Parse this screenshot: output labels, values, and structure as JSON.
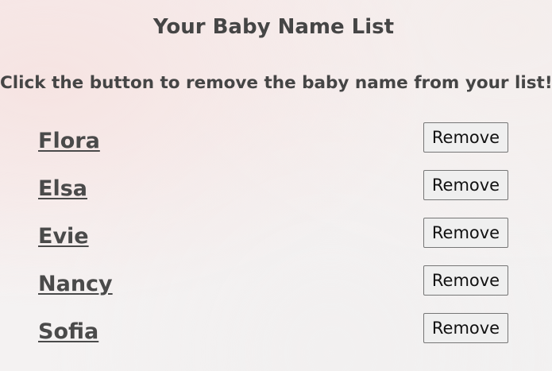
{
  "header": {
    "title": "Your Baby Name List",
    "instructions": "Click the button to remove the baby name from your list!"
  },
  "names": [
    {
      "name": "Flora",
      "button_label": "Remove"
    },
    {
      "name": "Elsa",
      "button_label": "Remove"
    },
    {
      "name": "Evie",
      "button_label": "Remove"
    },
    {
      "name": "Nancy",
      "button_label": "Remove"
    },
    {
      "name": "Sofia",
      "button_label": "Remove"
    }
  ]
}
